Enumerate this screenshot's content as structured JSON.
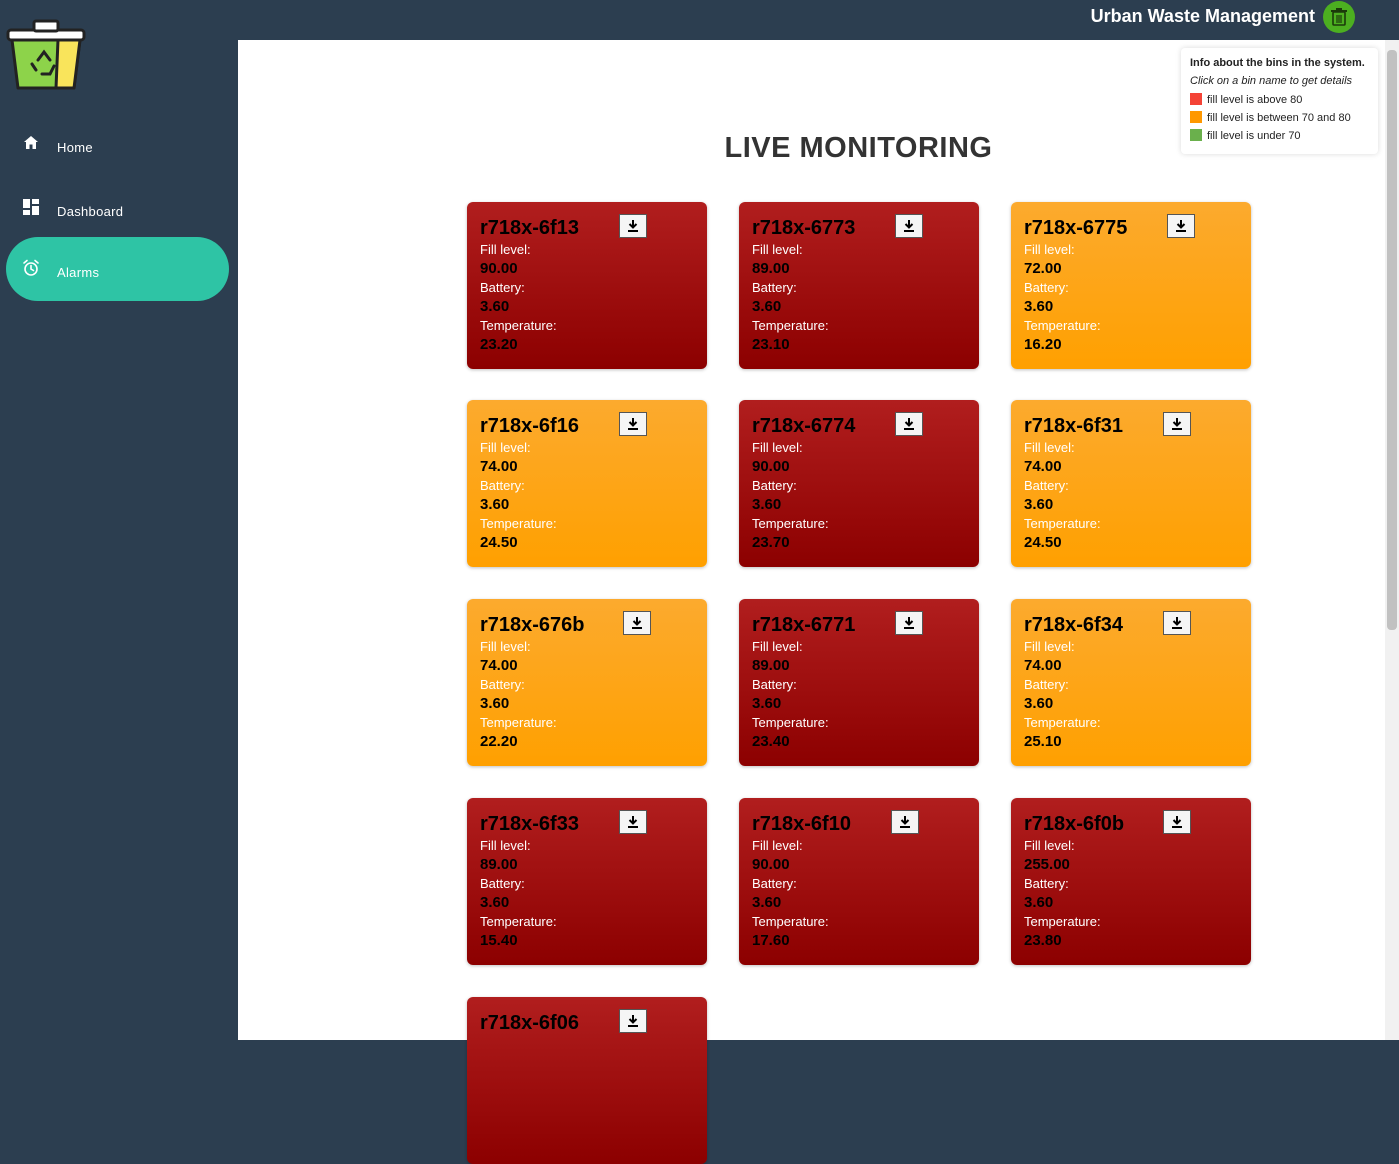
{
  "header": {
    "title": "Urban Waste Management",
    "brand_icon": "trash-bin-icon",
    "brand_color": "#4caf20"
  },
  "sidebar": {
    "items": [
      {
        "label": "Home",
        "icon": "home-icon",
        "active": false
      },
      {
        "label": "Dashboard",
        "icon": "dashboard-icon",
        "active": false
      },
      {
        "label": "Alarms",
        "icon": "alarm-clock-icon",
        "active": true
      }
    ],
    "active_color": "#2ec4a5"
  },
  "main": {
    "heading": "LIVE MONITORING"
  },
  "info": {
    "title": "Info about the bins in the system.",
    "subtitle": "Click on a bin name to get details",
    "legend": [
      {
        "label": "fill level is above 80",
        "color": "#f44336"
      },
      {
        "label": "fill level is between 70 and 80",
        "color": "#ff9800"
      },
      {
        "label": "fill level is under 70",
        "color": "#6ab04c"
      }
    ]
  },
  "labels": {
    "fill": "Fill level:",
    "battery": "Battery:",
    "temperature": "Temperature:"
  },
  "bins": [
    {
      "name": "r718x-6f13",
      "fill": "90.00",
      "battery": "3.60",
      "temperature": "23.20",
      "status": "red"
    },
    {
      "name": "r718x-6773",
      "fill": "89.00",
      "battery": "3.60",
      "temperature": "23.10",
      "status": "red"
    },
    {
      "name": "r718x-6775",
      "fill": "72.00",
      "battery": "3.60",
      "temperature": "16.20",
      "status": "orange"
    },
    {
      "name": "r718x-6f16",
      "fill": "74.00",
      "battery": "3.60",
      "temperature": "24.50",
      "status": "orange"
    },
    {
      "name": "r718x-6774",
      "fill": "90.00",
      "battery": "3.60",
      "temperature": "23.70",
      "status": "red"
    },
    {
      "name": "r718x-6f31",
      "fill": "74.00",
      "battery": "3.60",
      "temperature": "24.50",
      "status": "orange"
    },
    {
      "name": "r718x-676b",
      "fill": "74.00",
      "battery": "3.60",
      "temperature": "22.20",
      "status": "orange"
    },
    {
      "name": "r718x-6771",
      "fill": "89.00",
      "battery": "3.60",
      "temperature": "23.40",
      "status": "red"
    },
    {
      "name": "r718x-6f34",
      "fill": "74.00",
      "battery": "3.60",
      "temperature": "25.10",
      "status": "orange"
    },
    {
      "name": "r718x-6f33",
      "fill": "89.00",
      "battery": "3.60",
      "temperature": "15.40",
      "status": "red"
    },
    {
      "name": "r718x-6f10",
      "fill": "90.00",
      "battery": "3.60",
      "temperature": "17.60",
      "status": "red"
    },
    {
      "name": "r718x-6f0b",
      "fill": "255.00",
      "battery": "3.60",
      "temperature": "23.80",
      "status": "red"
    },
    {
      "name": "r718x-6f06",
      "fill": "",
      "battery": "",
      "temperature": "",
      "status": "red"
    }
  ]
}
